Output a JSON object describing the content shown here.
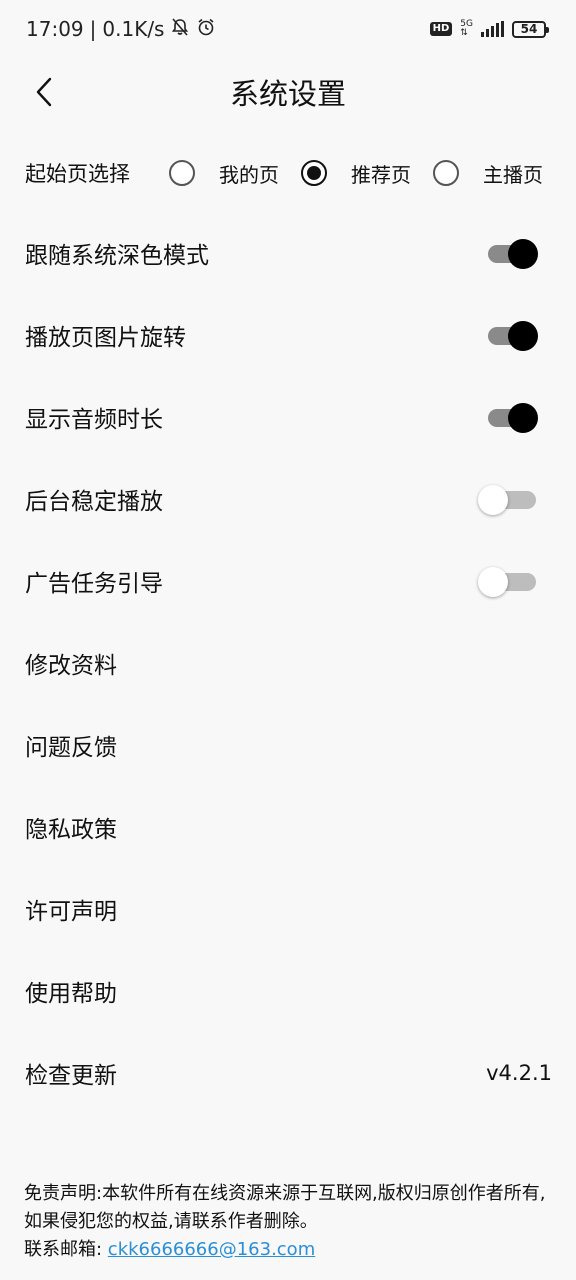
{
  "status_bar": {
    "time": "17:09",
    "separator": "|",
    "speed": "0.1K/s",
    "hd": "HD",
    "network": "5G",
    "battery": "54"
  },
  "header": {
    "title": "系统设置"
  },
  "start_page": {
    "label": "起始页选择",
    "options": [
      {
        "label": "我的页",
        "selected": false
      },
      {
        "label": "推荐页",
        "selected": true
      },
      {
        "label": "主播页",
        "selected": false
      }
    ]
  },
  "settings": [
    {
      "label": "跟随系统深色模式",
      "toggle": true
    },
    {
      "label": "播放页图片旋转",
      "toggle": true
    },
    {
      "label": "显示音频时长",
      "toggle": true
    },
    {
      "label": "后台稳定播放",
      "toggle": false
    },
    {
      "label": "广告任务引导",
      "toggle": false
    },
    {
      "label": "修改资料"
    },
    {
      "label": "问题反馈"
    },
    {
      "label": "隐私政策"
    },
    {
      "label": "许可声明"
    },
    {
      "label": "使用帮助"
    },
    {
      "label": "检查更新",
      "value": "v4.2.1"
    }
  ],
  "footer": {
    "disclaimer": "免责声明:本软件所有在线资源来源于互联网,版权归原创作者所有,如果侵犯您的权益,请联系作者删除。",
    "contact_label": "联系邮箱: ",
    "email": "ckk6666666@163.com"
  },
  "colors": {
    "background": "#f8f8f8",
    "switch_on": "#000000",
    "link": "#2a8fd6"
  }
}
